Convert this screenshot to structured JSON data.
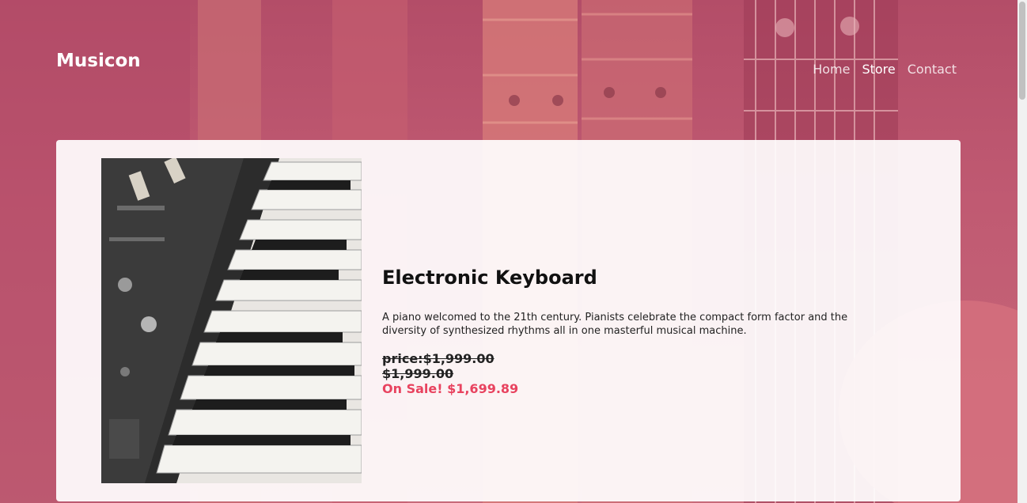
{
  "header": {
    "brand": "Musicon",
    "nav": [
      {
        "label": "Home",
        "active": false
      },
      {
        "label": "Store",
        "active": true
      },
      {
        "label": "Contact",
        "active": false
      }
    ]
  },
  "product": {
    "title": "Electronic Keyboard",
    "description": "A piano welcomed to the 21th century. Pianists celebrate the compact form factor and the diversity of synthesized rhythms all in one masterful musical machine.",
    "price_label": "price:$1,999.00",
    "original_price": "$1,999.00",
    "sale_price": "On Sale! $1,699.89",
    "image_icon": "keyboard-photo"
  },
  "colors": {
    "background_tint": "#b84f6b",
    "sale": "#e8435f"
  }
}
